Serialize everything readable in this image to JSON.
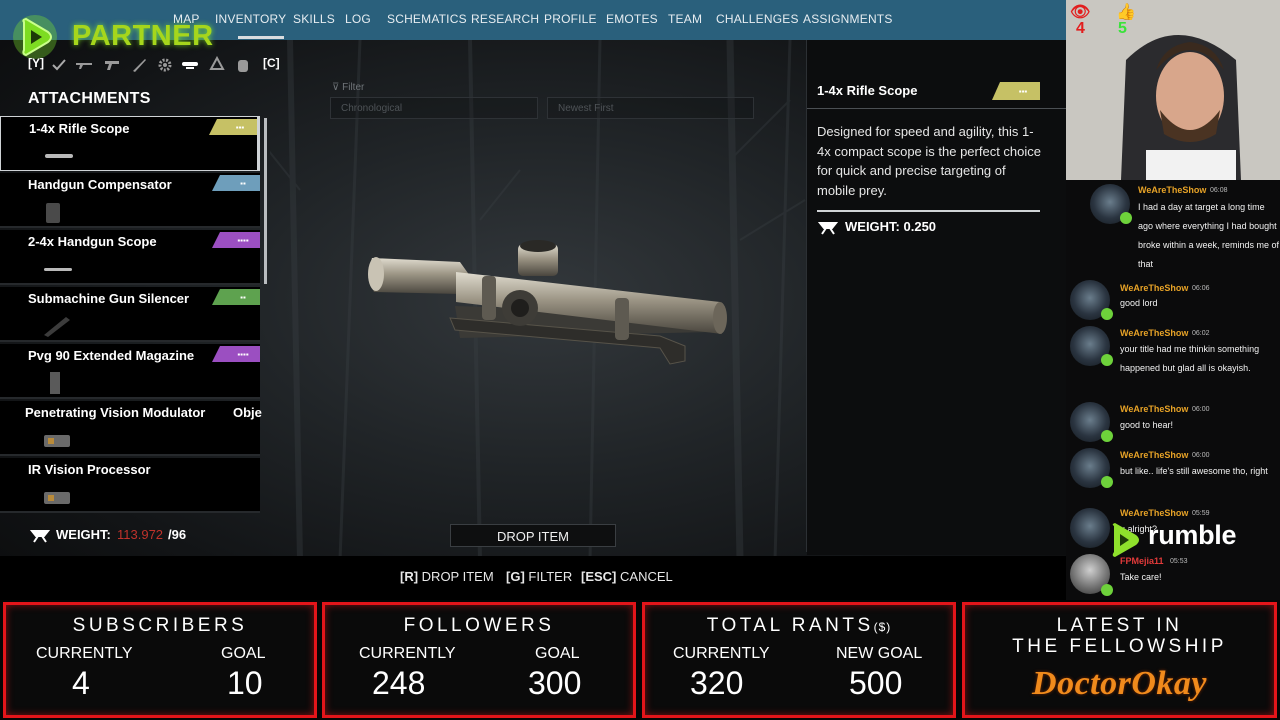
{
  "nav": [
    "MAP",
    "INVENTORY",
    "SKILLS",
    "LOG",
    "SCHEMATICS",
    "RESEARCH",
    "PROFILE",
    "EMOTES",
    "TEAM",
    "CHALLENGES",
    "ASSIGNMENTS"
  ],
  "overlay": {
    "partner_label": "PARTNER",
    "viewers": "4",
    "likes": "5",
    "rumble_label": "rumble"
  },
  "categories": {
    "left_key": "[Y]",
    "right_key": "[C]",
    "icons": [
      "check-icon",
      "rifle-icon",
      "pistol-icon",
      "knife-icon",
      "gear-icon",
      "scope-icon",
      "recycle-icon",
      "backpack-icon"
    ],
    "selected": "scope-icon"
  },
  "inventory": {
    "section_title": "ATTACHMENTS",
    "items": [
      {
        "name": "1-4x Rifle Scope",
        "rarity_color": "#c6c165"
      },
      {
        "name": "Handgun Compensator",
        "rarity_color": "#6e9ebb"
      },
      {
        "name": "2-4x Handgun Scope",
        "rarity_color": "#9b4fc1"
      },
      {
        "name": "Submachine Gun Silencer",
        "rarity_color": "#5ea24f"
      },
      {
        "name": "Pvg 90 Extended Magazine",
        "rarity_color": "#9b4fc1"
      },
      {
        "name": "Penetrating Vision Modulator",
        "rarity_color": "",
        "extra": "Obje"
      },
      {
        "name": "IR Vision Processor",
        "rarity_color": ""
      }
    ],
    "weight_label": "WEIGHT:",
    "weight_current": "113.972",
    "weight_max": "/96",
    "weight_over_color": "#c0322b"
  },
  "filter": {
    "label": "Filter",
    "sort": "Chronological",
    "order": "Newest First"
  },
  "detail": {
    "title": "1-4x Rifle Scope",
    "description": "Designed for speed and agility, this 1-4x compact scope is the perfect choice for quick and precise targeting of mobile prey.",
    "weight_label": "WEIGHT: 0.250"
  },
  "actions": {
    "drop_button": "DROP ITEM",
    "hint_drop_key": "[R]",
    "hint_drop": "DROP ITEM",
    "hint_filter_key": "[G]",
    "hint_filter": "FILTER",
    "hint_cancel_key": "[ESC]",
    "hint_cancel": "CANCEL"
  },
  "chat": [
    {
      "user": "WeAreTheShow",
      "time": "06:08",
      "text": "I had a day at target a long time ago where everything I had bought broke within a week, reminds me of that"
    },
    {
      "user": "WeAreTheShow",
      "time": "06:06",
      "text": "good lord"
    },
    {
      "user": "WeAreTheShow",
      "time": "06:02",
      "text": "your title had me thinkin something happened but glad all is okayish."
    },
    {
      "user": "WeAreTheShow",
      "time": "06:00",
      "text": "good to hear!"
    },
    {
      "user": "WeAreTheShow",
      "time": "06:00",
      "text": "but like.. life's still awesome tho, right"
    },
    {
      "user": "WeAreTheShow",
      "time": "05:59",
      "text": "u alright?"
    },
    {
      "user": "FPMejia11",
      "time": "05:53",
      "text": "Take care!"
    }
  ],
  "stats": {
    "subscribers": {
      "title": "SUBSCRIBERS",
      "current_label": "CURRENTLY",
      "current": "4",
      "goal_label": "GOAL",
      "goal": "10"
    },
    "followers": {
      "title": "FOLLOWERS",
      "current_label": "CURRENTLY",
      "current": "248",
      "goal_label": "GOAL",
      "goal": "300"
    },
    "rants": {
      "title": "TOTAL RANTS",
      "unit": "($)",
      "current_label": "CURRENTLY",
      "current": "320",
      "goal_label": "NEW GOAL",
      "goal": "500"
    },
    "fellowship": {
      "title_1": "LATEST IN",
      "title_2": "THE FELLOWSHIP",
      "name": "DoctorOkay"
    }
  },
  "colors": {
    "topbar": "#2a607c",
    "accent_red": "#e3151a",
    "chat_name": "#e6a227"
  }
}
